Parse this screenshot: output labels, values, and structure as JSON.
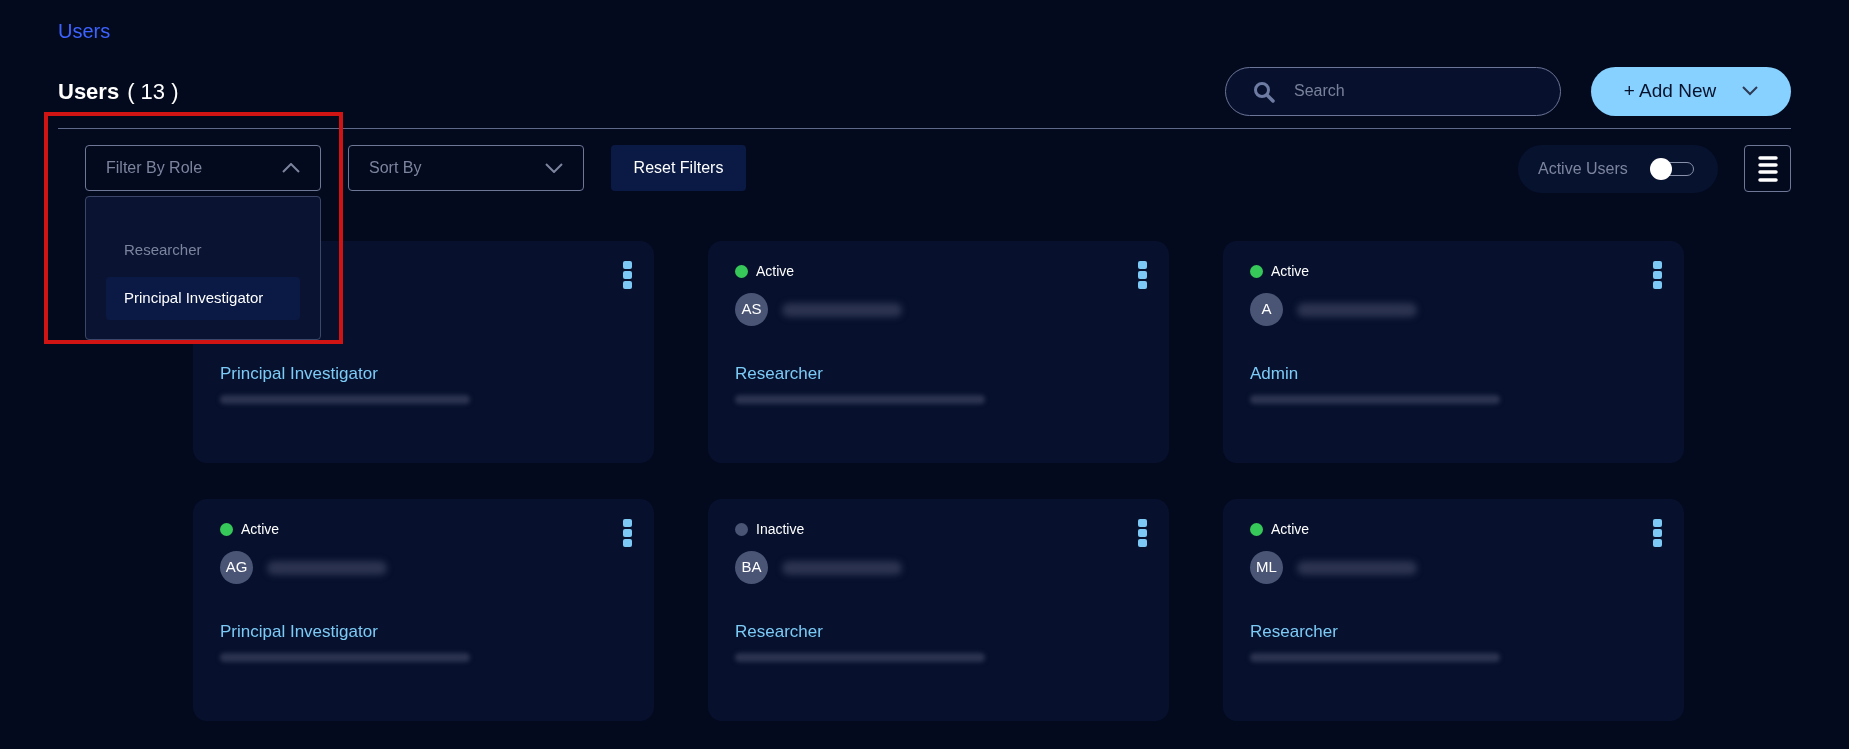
{
  "breadcrumb": "Users",
  "header": {
    "title": "Users",
    "count": "( 13 )"
  },
  "search": {
    "placeholder": "Search"
  },
  "add_button": {
    "label": "+ Add New"
  },
  "filters": {
    "role": {
      "placeholder": "Filter By Role",
      "expanded": true,
      "options": [
        {
          "label": "Researcher",
          "selected": false
        },
        {
          "label": "Principal Investigator",
          "selected": true
        }
      ]
    },
    "sort": {
      "placeholder": "Sort By",
      "expanded": false
    },
    "reset": "Reset Filters",
    "active_users": {
      "label": "Active Users",
      "on": false
    }
  },
  "cards": [
    {
      "role": "Principal Investigator"
    },
    {
      "status": "Active",
      "active": true,
      "initials": "AS",
      "role": "Researcher"
    },
    {
      "status": "Active",
      "active": true,
      "initials": "A",
      "role": "Admin"
    },
    {
      "status": "Active",
      "active": true,
      "initials": "AG",
      "role": "Principal Investigator"
    },
    {
      "status": "Inactive",
      "active": false,
      "initials": "BA",
      "role": "Researcher"
    },
    {
      "status": "Active",
      "active": true,
      "initials": "ML",
      "role": "Researcher"
    }
  ]
}
